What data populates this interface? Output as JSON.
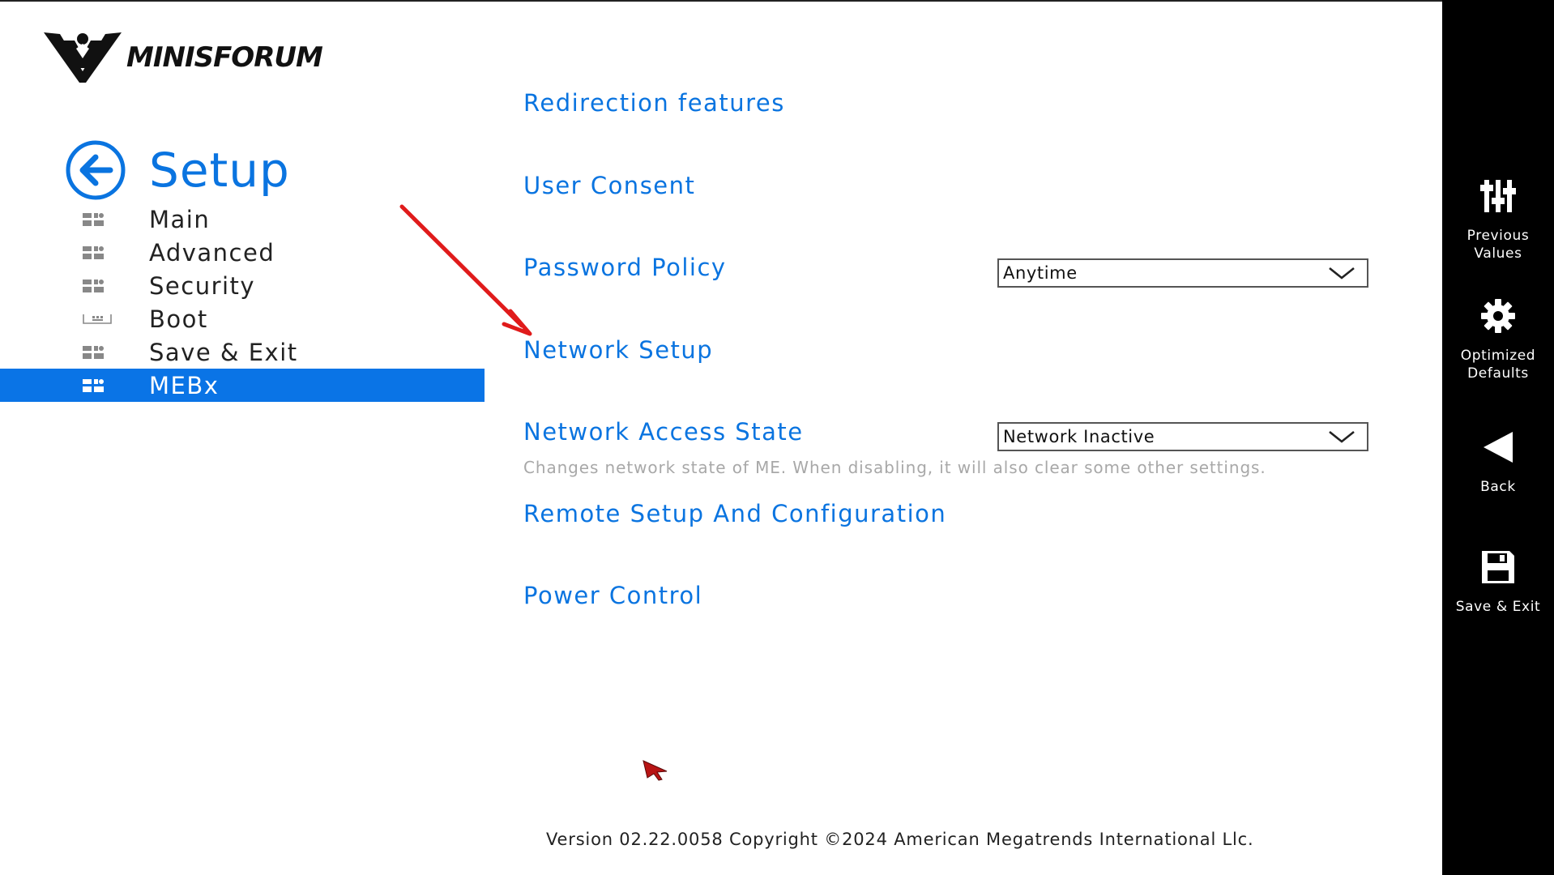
{
  "logo": {
    "text": "MINISFORUM"
  },
  "header": {
    "title": "Setup"
  },
  "nav": {
    "items": [
      {
        "label": "Main",
        "icon": "app-grid-icon",
        "active": false
      },
      {
        "label": "Advanced",
        "icon": "app-grid-icon",
        "active": false
      },
      {
        "label": "Security",
        "icon": "app-grid-icon",
        "active": false
      },
      {
        "label": "Boot",
        "icon": "boot-tray-icon",
        "active": false
      },
      {
        "label": "Save & Exit",
        "icon": "app-grid-icon",
        "active": false
      },
      {
        "label": "MEBx",
        "icon": "app-grid-icon",
        "active": true
      }
    ]
  },
  "main": {
    "items": [
      {
        "label": "Redirection features"
      },
      {
        "label": "User Consent"
      },
      {
        "label": "Password Policy",
        "value": "Anytime"
      },
      {
        "label": "Network Setup"
      },
      {
        "label": "Network Access State",
        "value": "Network Inactive",
        "help": "Changes network state of ME. When disabling, it will also clear some other settings."
      },
      {
        "label": "Remote Setup And Configuration"
      },
      {
        "label": "Power Control"
      }
    ]
  },
  "toolbar": {
    "previous_values": "Previous Values",
    "optimized_defaults": "Optimized Defaults",
    "back": "Back",
    "save_exit": "Save & Exit"
  },
  "footer": {
    "version": "Version 02.22.0058 Copyright ©2024 American Megatrends International Llc."
  },
  "colors": {
    "accent": "#0a74e0",
    "active_bg": "#0a74e6",
    "toolbar_bg": "#000000",
    "help_text": "#a8a8a8",
    "annotation_arrow": "#e01b1b"
  }
}
